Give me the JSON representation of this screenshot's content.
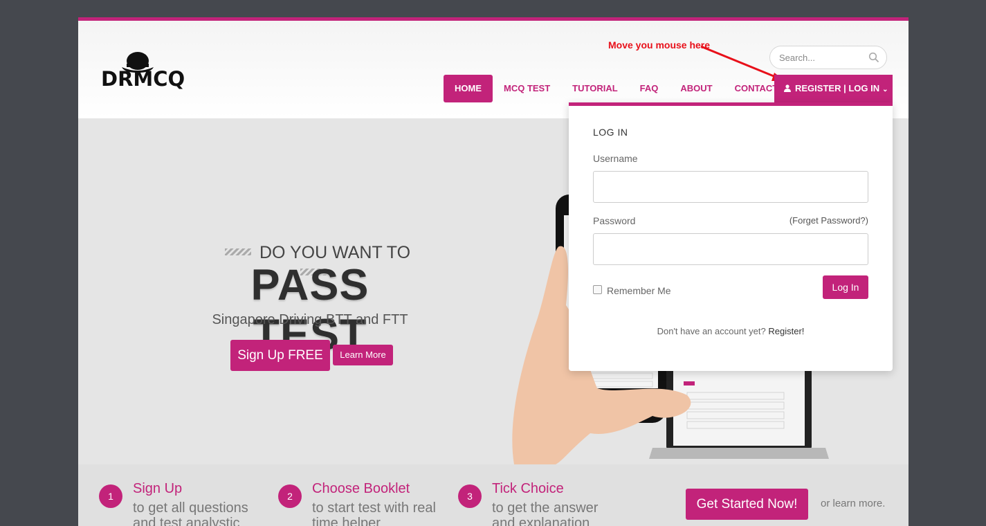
{
  "header": {
    "logo_text": "DRMCQ",
    "search_placeholder": "Search...",
    "annotation": "Move you mouse here"
  },
  "nav": {
    "items": [
      {
        "label": "HOME"
      },
      {
        "label": "MCQ TEST"
      },
      {
        "label": "TUTORIAL"
      },
      {
        "label": "FAQ"
      },
      {
        "label": "ABOUT"
      },
      {
        "label": "CONTACT"
      }
    ],
    "login_label": "REGISTER | LOG IN"
  },
  "hero": {
    "pretitle": "DO YOU WANT TO",
    "title": "PASS TEST",
    "subtitle": "Singapore Driving BTT and FTT",
    "signup_label": "Sign Up FREE",
    "learn_label": "Learn More"
  },
  "steps": [
    {
      "num": "1",
      "title": "Sign Up",
      "desc": "to get all questions and test analystic"
    },
    {
      "num": "2",
      "title": "Choose Booklet",
      "desc": "to start test with real time helper"
    },
    {
      "num": "3",
      "title": "Tick Choice",
      "desc": "to get the answer and explanation"
    }
  ],
  "cta": {
    "start_label": "Get Started Now!",
    "or_learn": "or learn more."
  },
  "login_form": {
    "title": "LOG IN",
    "username_label": "Username",
    "password_label": "Password",
    "forget_label": "(Forget Password?)",
    "remember_label": "Remember Me",
    "login_button": "Log In",
    "no_account": "Don't have an account yet?",
    "register_link": "Register!"
  },
  "colors": {
    "accent": "#c2237a",
    "annotation": "#e8101a"
  }
}
